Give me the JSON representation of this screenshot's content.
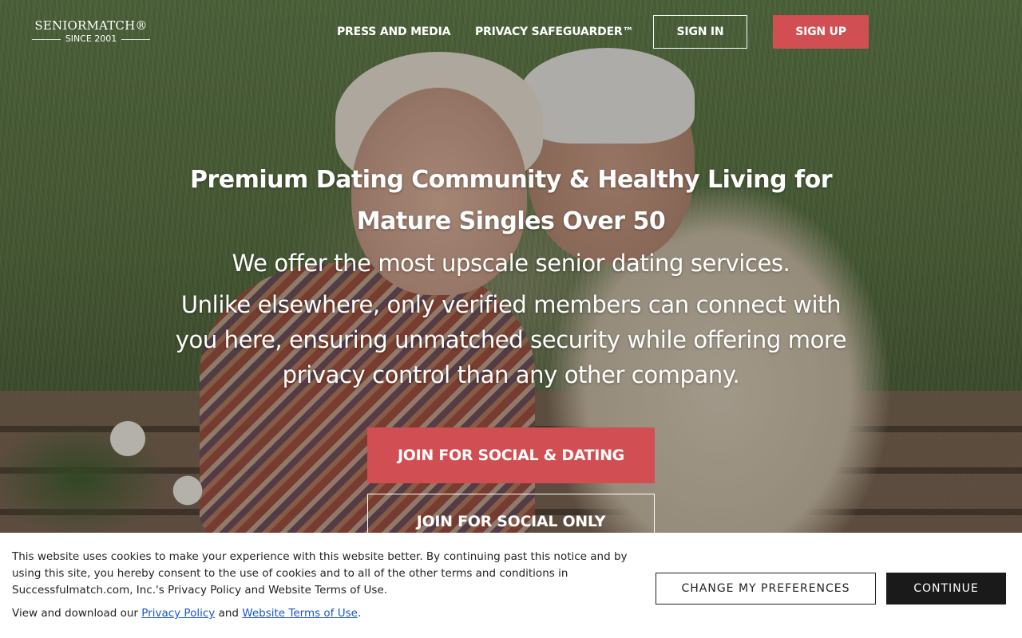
{
  "header": {
    "logo_name": "SENIORMATCH®",
    "logo_tagline": "SINCE 2001",
    "nav": [
      {
        "label": "PRESS AND MEDIA"
      },
      {
        "label": "PRIVACY SAFEGUARDER™"
      }
    ],
    "sign_in_label": "SIGN IN",
    "sign_up_label": "SIGN UP"
  },
  "hero": {
    "headline": "Premium Dating Community & Healthy Living for Mature Singles Over 50",
    "subheadline": "We offer the most upscale senior dating services.",
    "paragraph": "Unlike elsewhere, only verified members can connect with you here, ensuring unmatched security while offering more privacy control than any other company.",
    "cta_primary": "JOIN FOR SOCIAL & DATING",
    "cta_secondary": "JOIN FOR SOCIAL ONLY"
  },
  "cookie_banner": {
    "text": "This website uses cookies to make your experience with this website better. By continuing past this notice and by using this site, you hereby consent to the use of cookies and to all of the other terms and conditions in Successfulmatch.com, Inc.'s Privacy Policy and Website Terms of Use.",
    "links_prefix": "View and download our",
    "privacy_link": "Privacy Policy",
    "links_and": "and",
    "terms_link": "Website Terms of Use",
    "links_suffix": ".",
    "preferences_label": "CHANGE MY PREFERENCES",
    "continue_label": "CONTINUE"
  },
  "colors": {
    "accent": "#d14f52",
    "dark_button": "#1a1a1a",
    "link": "#1a56c8"
  }
}
